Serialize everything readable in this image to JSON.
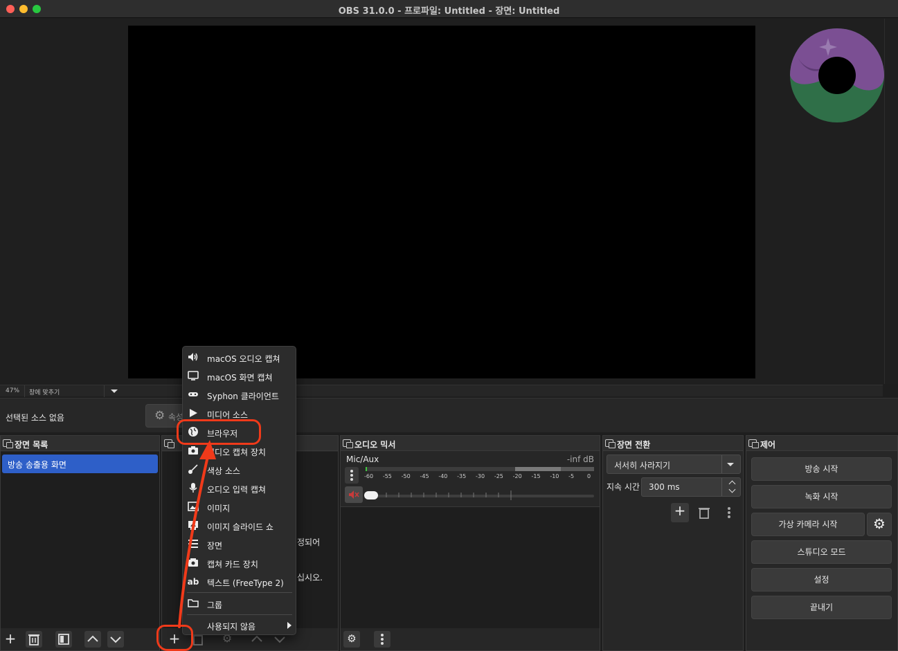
{
  "window": {
    "title": "OBS 31.0.0 - 프로파일: Untitled - 장면: Untitled"
  },
  "preview": {
    "zoom": "47%",
    "fit_mode": "창에 맞추기"
  },
  "source_toolbar": {
    "no_source": "선택된 소스 없음",
    "properties": "속성"
  },
  "scenes": {
    "title": "장면 목록",
    "items": [
      "방송 송출용 화면"
    ]
  },
  "sources": {
    "hint_line1": "정되어",
    "hint_line2": "십시오."
  },
  "mixer": {
    "title": "오디오 믹서",
    "track_name": "Mic/Aux",
    "level": "-inf dB",
    "scale": [
      "-60",
      "-55",
      "-50",
      "-45",
      "-40",
      "-35",
      "-30",
      "-25",
      "-20",
      "-15",
      "-10",
      "-5",
      "0"
    ]
  },
  "transitions": {
    "title": "장면 전환",
    "selected": "서서히 사라지기",
    "duration_label": "지속 시간",
    "duration": "300 ms"
  },
  "controls": {
    "title": "제어",
    "start_streaming": "방송 시작",
    "start_recording": "녹화 시작",
    "start_virtualcam": "가상 카메라 시작",
    "studio_mode": "스튜디오 모드",
    "settings": "설정",
    "exit": "끝내기"
  },
  "add_source_menu": {
    "items": [
      {
        "label": "macOS 오디오 캡쳐",
        "icon": "speaker-icon"
      },
      {
        "label": "macOS 화면 캡쳐",
        "icon": "monitor-icon"
      },
      {
        "label": "Syphon 클라이언트",
        "icon": "gamepad-icon"
      },
      {
        "label": "미디어 소스",
        "icon": "play-icon"
      },
      {
        "label": "브라우저",
        "icon": "globe-icon"
      },
      {
        "label": "비디오 캡쳐 장치",
        "icon": "camera-icon"
      },
      {
        "label": "색상 소스",
        "icon": "brush-icon"
      },
      {
        "label": "오디오 입력 캡쳐",
        "icon": "microphone-icon"
      },
      {
        "label": "이미지",
        "icon": "image-icon"
      },
      {
        "label": "이미지 슬라이드 쇼",
        "icon": "slideshow-icon"
      },
      {
        "label": "장면",
        "icon": "list-icon"
      },
      {
        "label": "캡쳐 카드 장치",
        "icon": "capture-card-icon"
      },
      {
        "label": "텍스트 (FreeType 2)",
        "icon": "text-icon"
      }
    ],
    "group": "그룹",
    "deprecated": "사용되지 않음"
  },
  "colors": {
    "highlight": "#f03a1a",
    "selection": "#2e5fc8",
    "logo_purple": "#7b4f93",
    "logo_green": "#2f6f48"
  }
}
